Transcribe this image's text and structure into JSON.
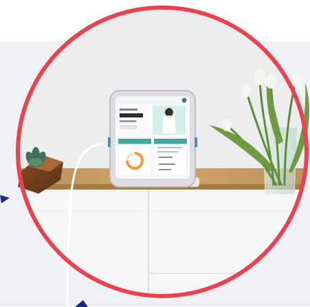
{
  "scene": {
    "wall_color": "#eeeeef",
    "countertop_color": "#c79a62",
    "cabinet_color": "#ffffff",
    "ring_color": "#e8434f",
    "arrow_color": "#1f2a7a"
  },
  "tablet": {
    "header": "",
    "balance_heading": "",
    "balance_value": "",
    "left_card_label": "",
    "right_card_label": "",
    "gauge_value": "",
    "icons": [
      "avatar-icon",
      "illustration-woman-icon",
      "gauge-icon"
    ]
  }
}
